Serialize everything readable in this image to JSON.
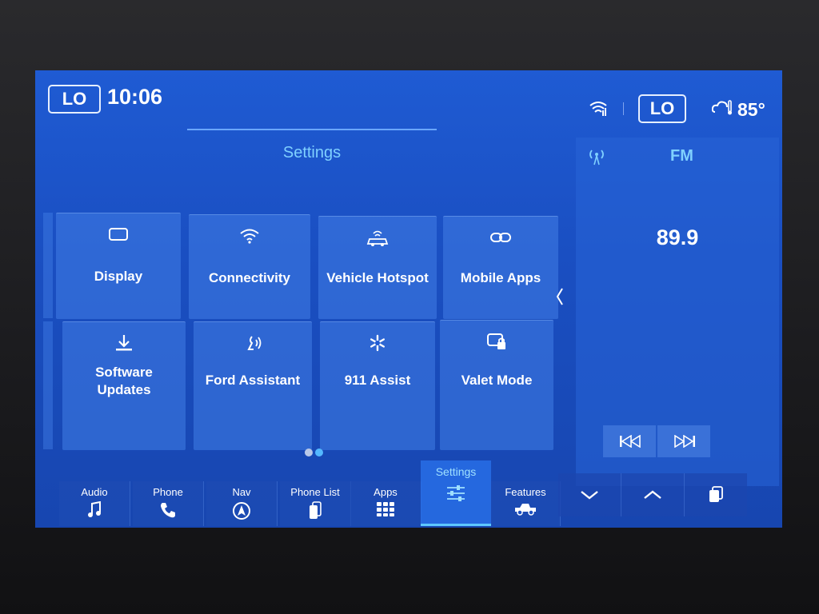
{
  "status": {
    "left_temp_setting": "LO",
    "time": "10:06",
    "right_temp_setting": "LO",
    "outside_temp": "85°",
    "icons": [
      "wireless-charging-icon",
      "weather-icon"
    ]
  },
  "settings": {
    "title": "Settings",
    "tiles": [
      {
        "label": "Display",
        "icon": "display-icon"
      },
      {
        "label": "Connectivity",
        "icon": "wifi-icon"
      },
      {
        "label": "Vehicle Hotspot",
        "icon": "vehicle-hotspot-icon"
      },
      {
        "label": "Mobile Apps",
        "icon": "link-icon"
      },
      {
        "label_line1": "Software",
        "label_line2": "Updates",
        "icon": "download-icon"
      },
      {
        "label": "Ford Assistant",
        "icon": "assistant-icon"
      },
      {
        "label": "911 Assist",
        "icon": "emergency-icon"
      },
      {
        "label": "Valet Mode",
        "icon": "valet-lock-icon"
      }
    ],
    "page_indicator": {
      "pages": 2,
      "current": 2
    }
  },
  "radio": {
    "band": "FM",
    "frequency": "89.9",
    "icons": [
      "antenna-icon",
      "seek-back-icon",
      "seek-forward-icon"
    ]
  },
  "nav": {
    "items": [
      {
        "label": "Audio",
        "icon": "music-note-icon"
      },
      {
        "label": "Phone",
        "icon": "phone-icon"
      },
      {
        "label": "Nav",
        "icon": "navigation-icon"
      },
      {
        "label": "Phone List",
        "icon": "phone-list-icon"
      },
      {
        "label": "Apps",
        "icon": "apps-grid-icon"
      },
      {
        "label": "Settings",
        "icon": "settings-sliders-icon",
        "active": true
      },
      {
        "label": "Features",
        "icon": "truck-icon"
      }
    ],
    "controls": [
      "chevron-down-icon",
      "chevron-up-icon",
      "copy-screens-icon"
    ]
  },
  "colors": {
    "screen": "#1a4fc2",
    "accent_cyan": "#7fd0ff",
    "tile": "#427ee6"
  }
}
